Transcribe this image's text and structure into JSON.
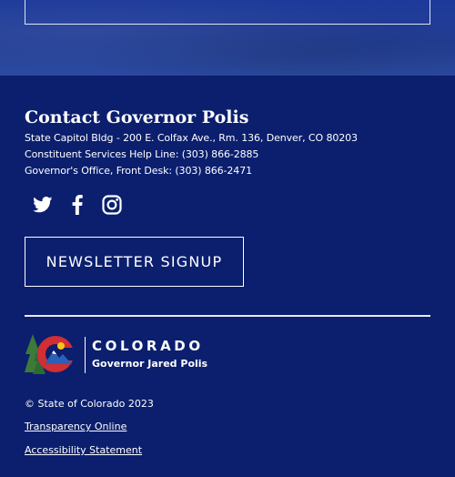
{
  "contact": {
    "title": "Contact Governor Polis",
    "address": "State Capitol Bldg - 200 E. Colfax Ave., Rm. 136, Denver, CO 80203",
    "helpline": "Constituent Services Help Line: (303) 866-2885",
    "office": "Governor's Office, Front Desk: (303) 866-2471"
  },
  "social": [
    {
      "name": "twitter",
      "icon": "twitter-icon"
    },
    {
      "name": "facebook",
      "icon": "facebook-icon"
    },
    {
      "name": "instagram",
      "icon": "instagram-icon"
    }
  ],
  "newsletter": {
    "label": "NEWSLETTER SIGNUP"
  },
  "logo": {
    "wordmark": "COLORADO",
    "subtitle": "Governor Jared Polis"
  },
  "footer": {
    "copyright": "© State of Colorado 2023",
    "links": [
      "Transparency Online",
      "Accessibility Statement"
    ]
  },
  "colors": {
    "background": "#0b1f6e",
    "text": "#ffffff",
    "logo_red": "#d12e35",
    "logo_yellow": "#f4c51a",
    "logo_green": "#3d7a3a",
    "logo_blue": "#2a60b5"
  }
}
